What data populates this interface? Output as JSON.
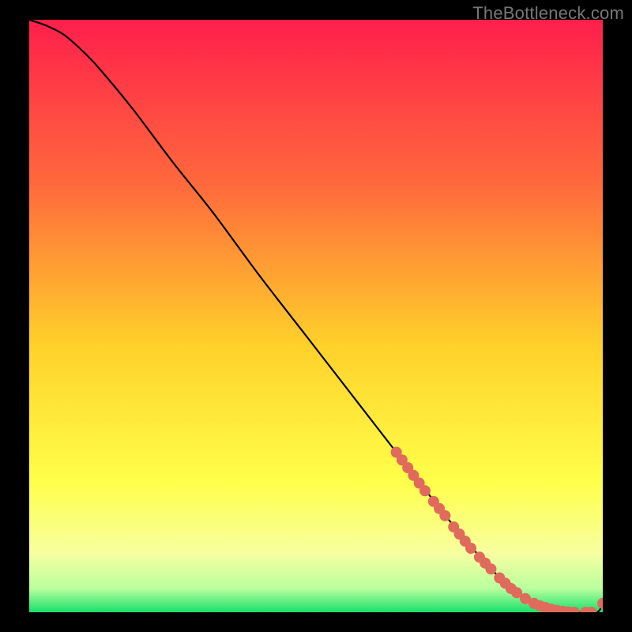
{
  "watermark": "TheBottleneck.com",
  "chart_data": {
    "type": "line",
    "title": "",
    "xlabel": "",
    "ylabel": "",
    "xlim": [
      0,
      100
    ],
    "ylim": [
      0,
      100
    ],
    "grid": false,
    "legend": false,
    "background_gradient": {
      "stops": [
        {
          "pct": 0,
          "color": "#ff1f4b"
        },
        {
          "pct": 28,
          "color": "#ff6a3c"
        },
        {
          "pct": 55,
          "color": "#ffd12a"
        },
        {
          "pct": 78,
          "color": "#ffff4a"
        },
        {
          "pct": 90,
          "color": "#f7ffa0"
        },
        {
          "pct": 96,
          "color": "#b9ff9e"
        },
        {
          "pct": 100,
          "color": "#18e06a"
        }
      ]
    },
    "series": [
      {
        "name": "curve",
        "color": "#000000",
        "x": [
          0,
          3,
          6,
          9,
          12,
          18,
          25,
          32,
          40,
          48,
          56,
          64,
          72,
          78,
          84,
          88,
          92,
          96,
          99,
          100
        ],
        "y": [
          100,
          99,
          97.5,
          95,
          92,
          85,
          76,
          67.5,
          57,
          47,
          37,
          27,
          17,
          10,
          4,
          1.5,
          0.5,
          0,
          0,
          1.5
        ]
      }
    ],
    "markers": {
      "name": "highlight-dots",
      "color": "#e06a5c",
      "radius": 7,
      "points": [
        {
          "x": 64,
          "y": 27.0
        },
        {
          "x": 65,
          "y": 25.7
        },
        {
          "x": 66,
          "y": 24.4
        },
        {
          "x": 67,
          "y": 23.1
        },
        {
          "x": 68,
          "y": 21.8
        },
        {
          "x": 69,
          "y": 20.5
        },
        {
          "x": 70.5,
          "y": 18.7
        },
        {
          "x": 71.5,
          "y": 17.5
        },
        {
          "x": 72.5,
          "y": 16.3
        },
        {
          "x": 74,
          "y": 14.4
        },
        {
          "x": 75,
          "y": 13.2
        },
        {
          "x": 76,
          "y": 12.0
        },
        {
          "x": 77,
          "y": 10.8
        },
        {
          "x": 78.5,
          "y": 9.3
        },
        {
          "x": 79.5,
          "y": 8.3
        },
        {
          "x": 80.5,
          "y": 7.3
        },
        {
          "x": 82,
          "y": 5.8
        },
        {
          "x": 83,
          "y": 4.9
        },
        {
          "x": 84,
          "y": 4.0
        },
        {
          "x": 85,
          "y": 3.3
        },
        {
          "x": 86.5,
          "y": 2.3
        },
        {
          "x": 88,
          "y": 1.5
        },
        {
          "x": 89,
          "y": 1.1
        },
        {
          "x": 90,
          "y": 0.8
        },
        {
          "x": 91,
          "y": 0.5
        },
        {
          "x": 92,
          "y": 0.3
        },
        {
          "x": 93,
          "y": 0.15
        },
        {
          "x": 94,
          "y": 0.05
        },
        {
          "x": 95,
          "y": 0.0
        },
        {
          "x": 97,
          "y": 0.0
        },
        {
          "x": 98,
          "y": 0.0
        },
        {
          "x": 100,
          "y": 1.5
        }
      ]
    }
  }
}
